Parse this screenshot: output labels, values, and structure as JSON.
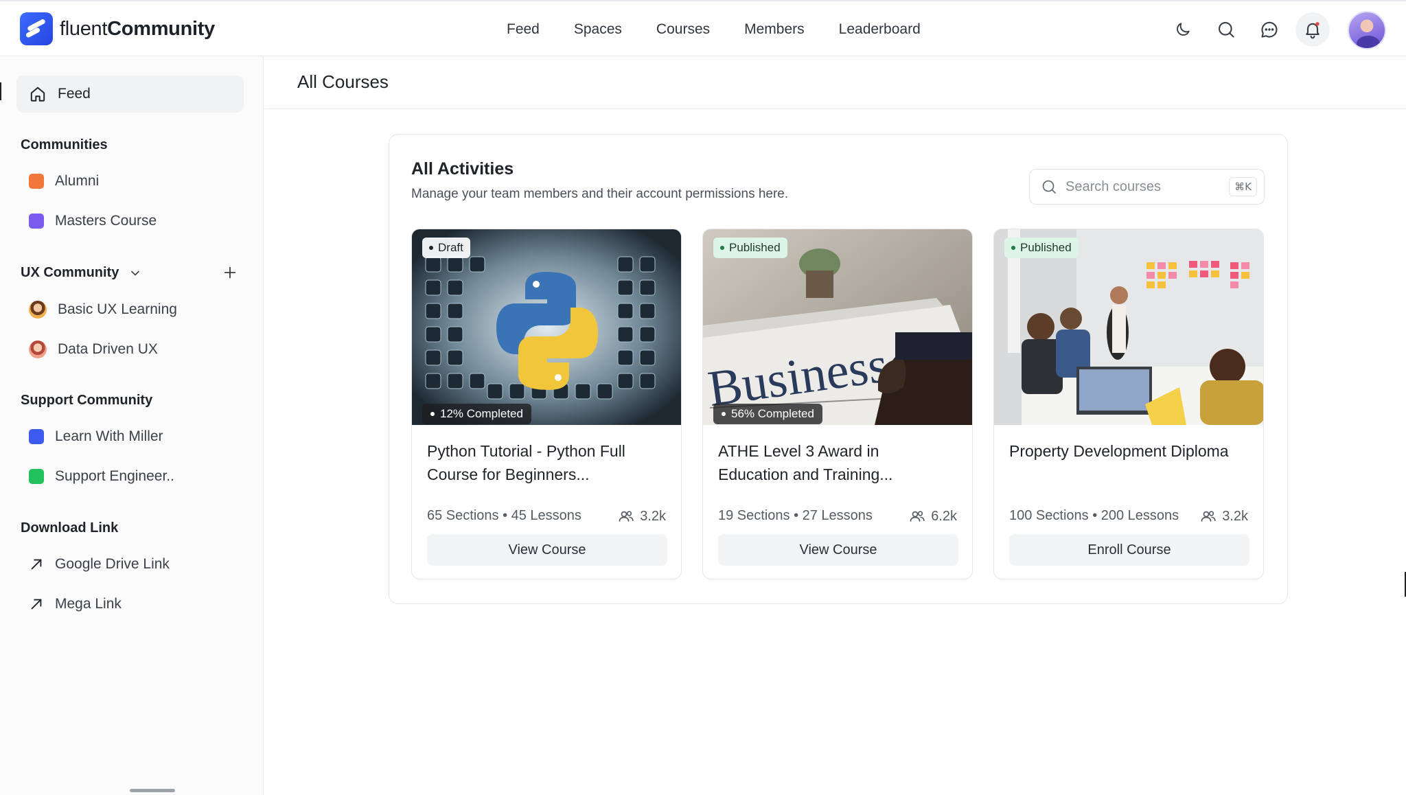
{
  "brand": {
    "name_light": "fluent",
    "name_bold": "Community"
  },
  "nav": {
    "items": [
      "Feed",
      "Spaces",
      "Courses",
      "Members",
      "Leaderboard"
    ]
  },
  "icons": {
    "theme": "moon-icon",
    "search": "search-icon",
    "chat": "chat-icon",
    "notifications": "bell-icon"
  },
  "sidebar": {
    "feed_label": "Feed",
    "communities_title": "Communities",
    "communities": [
      {
        "label": "Alumni",
        "color": "#f2773a"
      },
      {
        "label": "Masters Course",
        "color": "#7b5cf0"
      }
    ],
    "ux_title": "UX Community",
    "ux_items": [
      "Basic UX Learning",
      "Data Driven UX"
    ],
    "support_title": "Support Community",
    "support_items": [
      {
        "label": "Learn With Miller",
        "color": "#3d5af1"
      },
      {
        "label": "Support Engineer..",
        "color": "#21c25e"
      }
    ],
    "download_title": "Download Link",
    "download_items": [
      "Google Drive Link",
      "Mega Link"
    ]
  },
  "main": {
    "title": "All Courses",
    "panel_title": "All Activities",
    "panel_subtitle": "Manage your team members and their account permissions here.",
    "search_placeholder": "Search courses",
    "search_shortcut": "⌘K",
    "cards": [
      {
        "status": "Draft",
        "progress_label": "12% Completed",
        "progress": 12,
        "title": "Python Tutorial - Python Full Course for Beginners...",
        "meta": "65 Sections • 45 Lessons",
        "members": "3.2k",
        "button": "View Course"
      },
      {
        "status": "Published",
        "progress_label": "56% Completed",
        "progress": 56,
        "title": "ATHE Level 3 Award in Education and Training...",
        "meta": "19 Sections • 27 Lessons",
        "members": "6.2k",
        "button": "View Course",
        "image_text": "Business"
      },
      {
        "status": "Published",
        "title": "Property Development Diploma",
        "meta": "100 Sections • 200 Lessons",
        "members": "3.2k",
        "button": "Enroll Course"
      }
    ]
  }
}
